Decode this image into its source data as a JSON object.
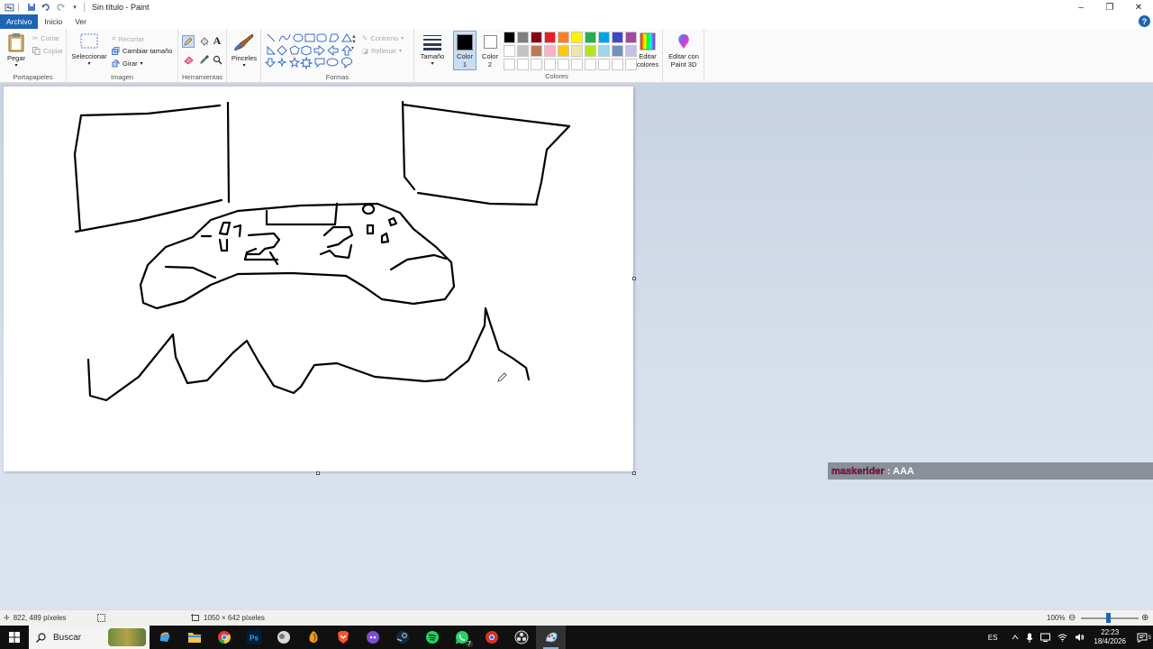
{
  "window": {
    "title": "Sin título - Paint",
    "minimize": "–",
    "maximize": "❐",
    "close": "✕"
  },
  "menu": {
    "file": "Archivo",
    "tabs": [
      "Inicio",
      "Ver"
    ],
    "help": "?"
  },
  "ribbon": {
    "clipboard": {
      "paste": "Pegar",
      "cut": "Cortar",
      "copy": "Copiar",
      "label": "Portapapeles"
    },
    "image": {
      "select": "Seleccionar",
      "crop": "Recortar",
      "resize": "Cambiar tamaño",
      "rotate": "Girar",
      "label": "Imagen"
    },
    "tools": {
      "label": "Herramientas",
      "text_glyph": "A"
    },
    "brushes": {
      "label": "Pinceles"
    },
    "shapes": {
      "outline": "Contorno",
      "fill": "Rellenar",
      "label": "Formas"
    },
    "size": {
      "label": "Tamaño"
    },
    "color1": {
      "label": "Color",
      "num": "1"
    },
    "color2": {
      "label": "Color",
      "num": "2"
    },
    "colors": {
      "label": "Colores",
      "edit": [
        "Editar",
        "colores"
      ],
      "palette": [
        "#000000",
        "#7f7f7f",
        "#880015",
        "#ed1c24",
        "#ff7f27",
        "#fff200",
        "#22b14c",
        "#00a2e8",
        "#3f48cc",
        "#a349a4",
        "#ffffff",
        "#c3c3c3",
        "#b97a57",
        "#ffaec9",
        "#ffc90e",
        "#efe4b0",
        "#b5e61d",
        "#99d9ea",
        "#7092be",
        "#c8bfe7",
        "#ffffff",
        "#ffffff",
        "#ffffff",
        "#ffffff",
        "#ffffff",
        "#ffffff",
        "#ffffff",
        "#ffffff",
        "#ffffff",
        "#ffffff"
      ]
    },
    "paint3d": {
      "label": [
        "Editar con",
        "Paint 3D"
      ]
    }
  },
  "overlay": {
    "user": "maskerider",
    "message": ": AAA"
  },
  "status": {
    "cursor_pos": "822, 489 píxeles",
    "image_size": "1050 × 642 píxeles",
    "zoom": "100%"
  },
  "taskbar": {
    "search_placeholder": "Buscar",
    "language": "ES",
    "time": "22:23",
    "date": "18/4/2026",
    "notifications": "5",
    "whatsapp_badge": "7"
  }
}
